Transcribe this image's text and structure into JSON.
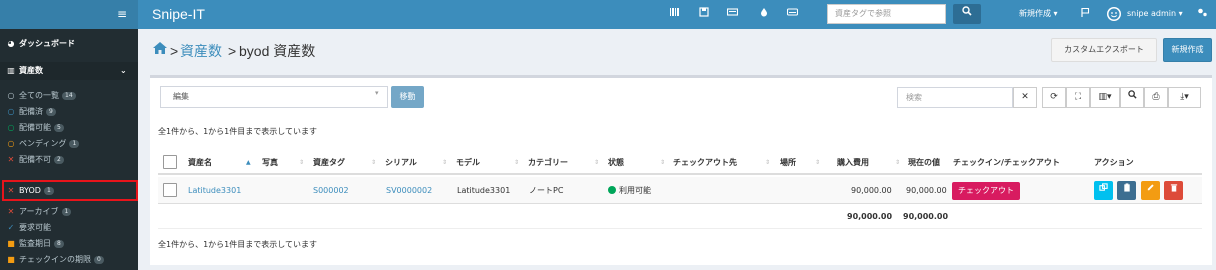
{
  "topbar": {
    "menu_icon": "≡",
    "brand": "Snipe-IT",
    "icons": [
      "barcode-icon",
      "save-icon",
      "keyboard-icon",
      "tint-icon",
      "hdd-icon"
    ],
    "search_placeholder": "資産タグで参照",
    "search_button_icon": "search-icon",
    "new_menu": "新規作成 ▾",
    "user_menu": "snipe admin ▾"
  },
  "sidebar": {
    "dashboard": "ダッシュボード",
    "assets_group": "資産数",
    "items": [
      {
        "label": "全ての一覧",
        "count": "14",
        "icon_color": "#b8c7ce",
        "icon": "○"
      },
      {
        "label": "配備済",
        "count": "9",
        "icon_color": "#3c8dbc",
        "icon": "○"
      },
      {
        "label": "配備可能",
        "count": "5",
        "icon_color": "#00a65a",
        "icon": "○"
      },
      {
        "label": "ペンディング",
        "count": "1",
        "icon_color": "#f39c12",
        "icon": "○"
      },
      {
        "label": "配備不可",
        "count": "2",
        "icon_color": "#dd4b39",
        "icon": "✕"
      },
      {
        "label": "BYOD",
        "count": "1",
        "icon_color": "#dd4b39",
        "icon": "✕"
      },
      {
        "label": "アーカイブ",
        "count": "1",
        "icon_color": "#dd4b39",
        "icon": "✕"
      },
      {
        "label": "要求可能",
        "count": "",
        "icon_color": "#3c8dbc",
        "icon": "✓"
      },
      {
        "label": "監査期日",
        "count": "8",
        "icon_color": "#f39c12",
        "icon": "■"
      },
      {
        "label": "チェックインの期限",
        "count": "0",
        "icon_color": "#f39c12",
        "icon": "■"
      }
    ]
  },
  "breadcrumb": {
    "parent": "資産数",
    "current": "byod 資産数"
  },
  "header_buttons": {
    "export": "カスタムエクスポート",
    "create": "新規作成"
  },
  "toolbar": {
    "bulk_action": "編集",
    "move_button": "移動",
    "search_placeholder": "検索"
  },
  "table": {
    "info_top": "全1件から、1から1件目まで表示しています",
    "info_bottom": "全1件から、1から1件目まで表示しています",
    "columns": [
      "資産名",
      "写真",
      "資産タグ",
      "シリアル",
      "モデル",
      "カテゴリー",
      "状態",
      "チェックアウト先",
      "場所",
      "購入費用",
      "現在の値",
      "チェックイン/チェックアウト",
      "アクション"
    ],
    "rows": [
      {
        "name": "Latitude3301",
        "asset_tag": "S000002",
        "serial": "SV0000002",
        "model": "Latitude3301",
        "category": "ノートPC",
        "status": "利用可能",
        "purchase_cost": "90,000.00",
        "current_value": "90,000.00",
        "checkout_button": "チェックアウト"
      }
    ],
    "totals": {
      "purchase_cost": "90,000.00",
      "current_value": "90,000.00"
    }
  }
}
